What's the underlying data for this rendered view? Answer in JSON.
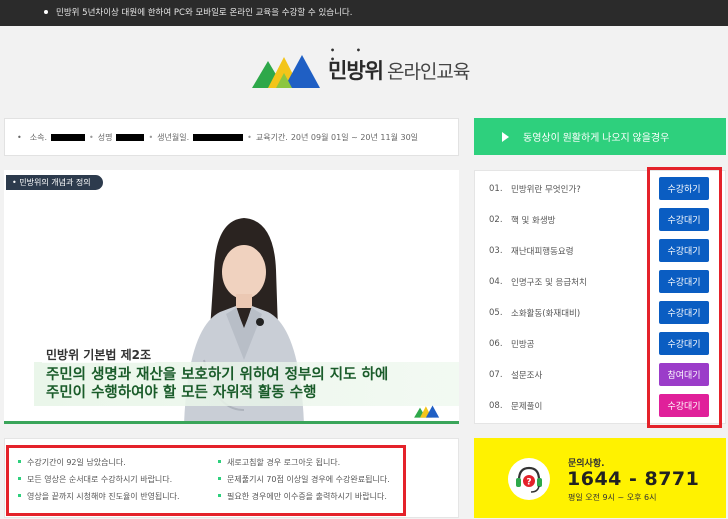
{
  "topbar": {
    "notice": "민방위 5년차이상 대원에 한하여 PC와 모바일로 온라인 교육을 수강할 수 있습니다."
  },
  "logo": {
    "brand": "민방위",
    "dots": "• • •",
    "sub": "온라인교육"
  },
  "info": {
    "affiliation_label": "소속.",
    "name_label": "성명",
    "birth_label": "생년월일.",
    "period_label": "교육기간.",
    "period_value": "20년 09월 01일 ~ 20년 11월 30일"
  },
  "video_help": {
    "label": "동영상이 원활하게 나오지 않을경우"
  },
  "video": {
    "tag": "• 민방위의 개념과 정의",
    "law_title": "민방위 기본법 제2조",
    "caption_line1": "주민의 생명과 재산을 보호하기 위하여 정부의 지도 하에",
    "caption_line2": "주민이 수행하여야 할 모든 자위적 활동 수행"
  },
  "lessons": [
    {
      "num": "01.",
      "title": "민방위란 무엇인가?",
      "button": "수강하기",
      "color": "#0a5dc2"
    },
    {
      "num": "02.",
      "title": "핵 및 화생방",
      "button": "수강대기",
      "color": "#0a5dc2"
    },
    {
      "num": "03.",
      "title": "재난대피행동요령",
      "button": "수강대기",
      "color": "#0a5dc2"
    },
    {
      "num": "04.",
      "title": "인명구조 및 응급처치",
      "button": "수강대기",
      "color": "#0a5dc2"
    },
    {
      "num": "05.",
      "title": "소화활동(화재대비)",
      "button": "수강대기",
      "color": "#0a5dc2"
    },
    {
      "num": "06.",
      "title": "민방공",
      "button": "수강대기",
      "color": "#0a5dc2"
    },
    {
      "num": "07.",
      "title": "설문조사",
      "button": "참여대기",
      "color": "#9b3cc9"
    },
    {
      "num": "08.",
      "title": "문제풀이",
      "button": "수강대기",
      "color": "#e0209a"
    }
  ],
  "notes": {
    "left": [
      "수강기간이 92일 남았습니다.",
      "모든 영상은 순서대로 수강하시기 바랍니다.",
      "영상을 끝까지 시청해야 진도율이 반영됩니다."
    ],
    "right": [
      "새로고침할 경우 로그아웃 됩니다.",
      "문제풀기시 70점 이상일 경우에 수강완료됩니다.",
      "필요한 경우에만 이수증을 출력하시기 바랍니다."
    ]
  },
  "contact": {
    "label": "문의사항.",
    "phone": "1644 - 8771",
    "hours": "평일 오전 9시 ~ 오후 6시"
  },
  "colors": {
    "accent_green": "#2ed07d",
    "button_blue": "#0a5dc2",
    "highlight_red": "#e4222a",
    "contact_yellow": "#fff200"
  }
}
